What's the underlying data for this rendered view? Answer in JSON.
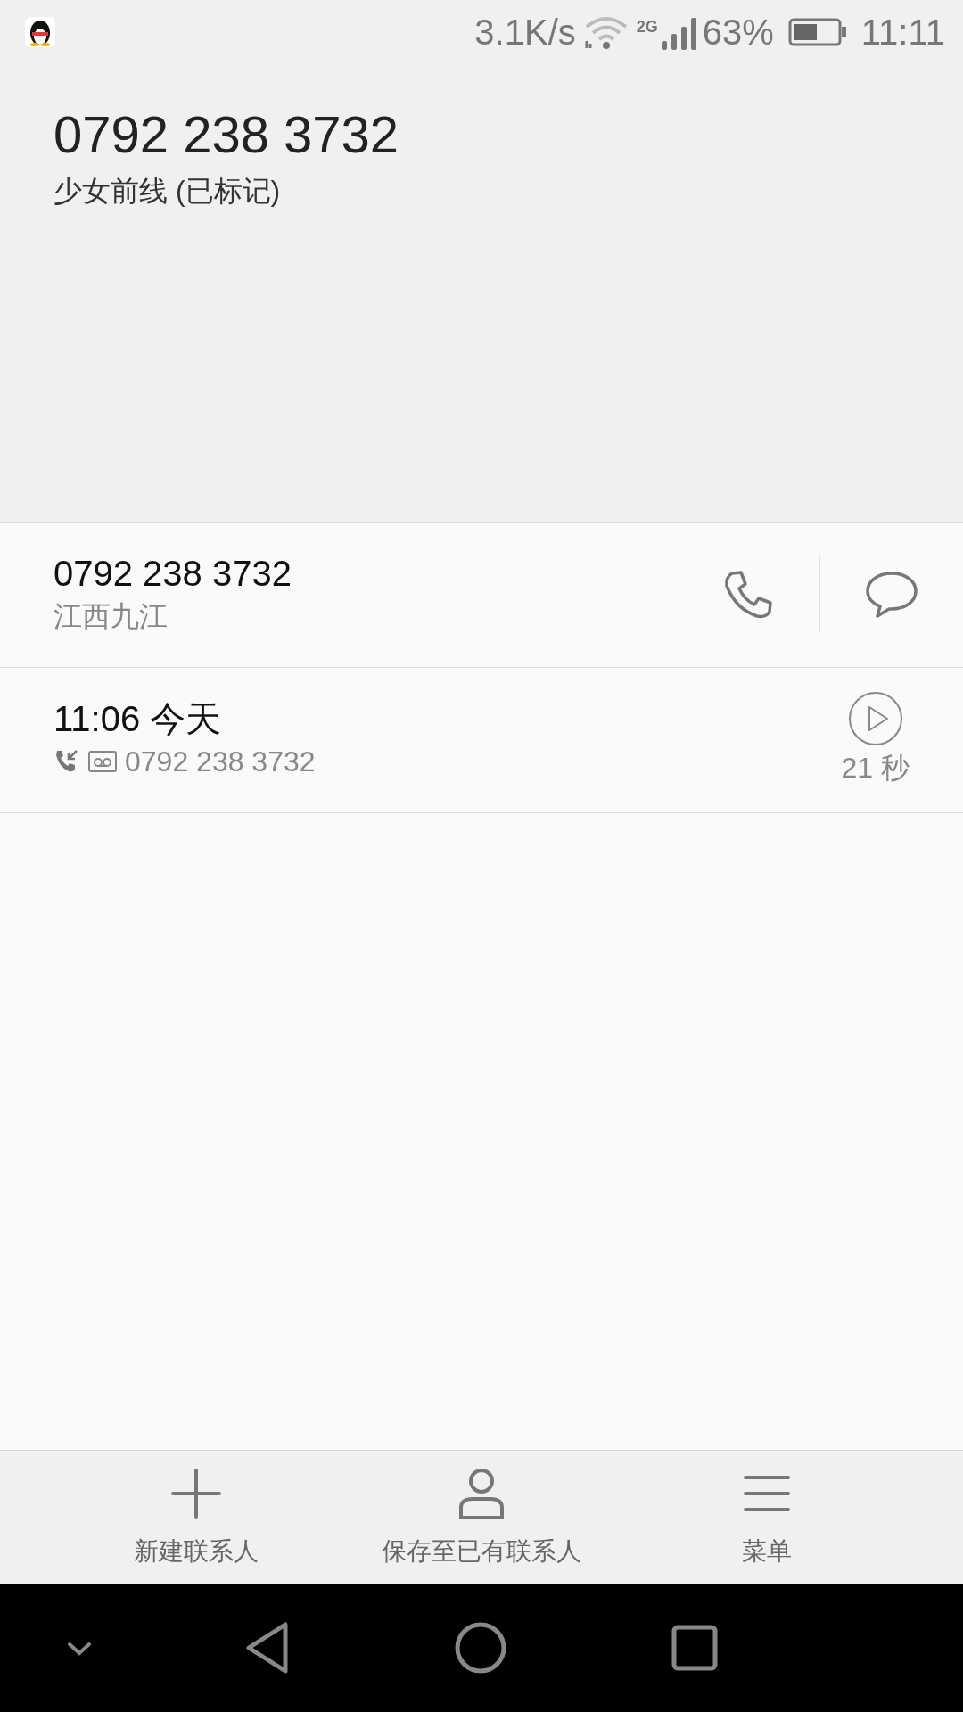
{
  "status_bar": {
    "net_speed": "3.1K/s",
    "network": "2G",
    "battery": "63%",
    "level": 0.63,
    "time": "11:11"
  },
  "header": {
    "number": "0792 238 3732",
    "label": "少女前线 (已标记)"
  },
  "number_row": {
    "number": "0792 238 3732",
    "location": "江西九江"
  },
  "calls": [
    {
      "time": "11:06 今天",
      "number": "0792 238 3732",
      "duration": "21 秒",
      "recorded": true
    }
  ],
  "bottom_actions": [
    {
      "kind": "add",
      "label": "新建联系人"
    },
    {
      "kind": "person",
      "label": "保存至已有联系人"
    },
    {
      "kind": "menu",
      "label": "菜单"
    }
  ]
}
